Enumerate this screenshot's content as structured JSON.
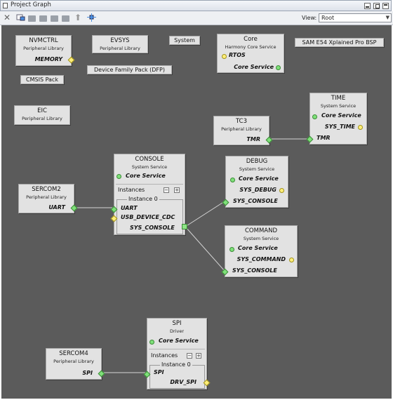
{
  "window": {
    "title": "Project Graph"
  },
  "toolbar": {
    "view_label": "View:",
    "view_value": "Root"
  },
  "nodes": {
    "nvmctrl": {
      "name": "NVMCTRL",
      "type": "Peripheral Library",
      "ports": [
        "MEMORY"
      ]
    },
    "evsys": {
      "name": "EVSYS",
      "type": "Peripheral Library"
    },
    "system": {
      "name": "System"
    },
    "core": {
      "name": "Core",
      "type": "Harmony Core Service",
      "ports": [
        "RTOS",
        "Core Service"
      ]
    },
    "bsp": {
      "name": "SAM E54 Xplained Pro BSP"
    },
    "dfp": {
      "name": "Device Family Pack (DFP)"
    },
    "cmsis": {
      "name": "CMSIS Pack"
    },
    "eic": {
      "name": "EIC",
      "type": "Peripheral Library"
    },
    "time": {
      "name": "TIME",
      "type": "System Service",
      "ports": [
        "Core Service",
        "SYS_TIME",
        "TMR"
      ]
    },
    "tc3": {
      "name": "TC3",
      "type": "Peripheral Library",
      "ports": [
        "TMR"
      ]
    },
    "console": {
      "name": "CONSOLE",
      "type": "System Service",
      "core": "Core Service",
      "instances": "Instances",
      "instance": "Instance 0",
      "ports": [
        "UART",
        "USB_DEVICE_CDC",
        "SYS_CONSOLE"
      ]
    },
    "sercom2": {
      "name": "SERCOM2",
      "type": "Peripheral Library",
      "ports": [
        "UART"
      ]
    },
    "debug": {
      "name": "DEBUG",
      "type": "System Service",
      "ports": [
        "Core Service",
        "SYS_DEBUG",
        "SYS_CONSOLE"
      ]
    },
    "command": {
      "name": "COMMAND",
      "type": "System Service",
      "ports": [
        "Core Service",
        "SYS_COMMAND",
        "SYS_CONSOLE"
      ]
    },
    "spi": {
      "name": "SPI",
      "type": "Driver",
      "core": "Core Service",
      "instances": "Instances",
      "instance": "Instance 0",
      "ports": [
        "SPI",
        "DRV_SPI"
      ]
    },
    "sercom4": {
      "name": "SERCOM4",
      "type": "Peripheral Library",
      "ports": [
        "SPI"
      ]
    }
  },
  "colors": {
    "canvas": "#5b5b5b",
    "node": "#e2e2e2",
    "port_green": "#7fe07a",
    "port_yellow": "#ffef7a",
    "wire": "#d0d0d0"
  }
}
